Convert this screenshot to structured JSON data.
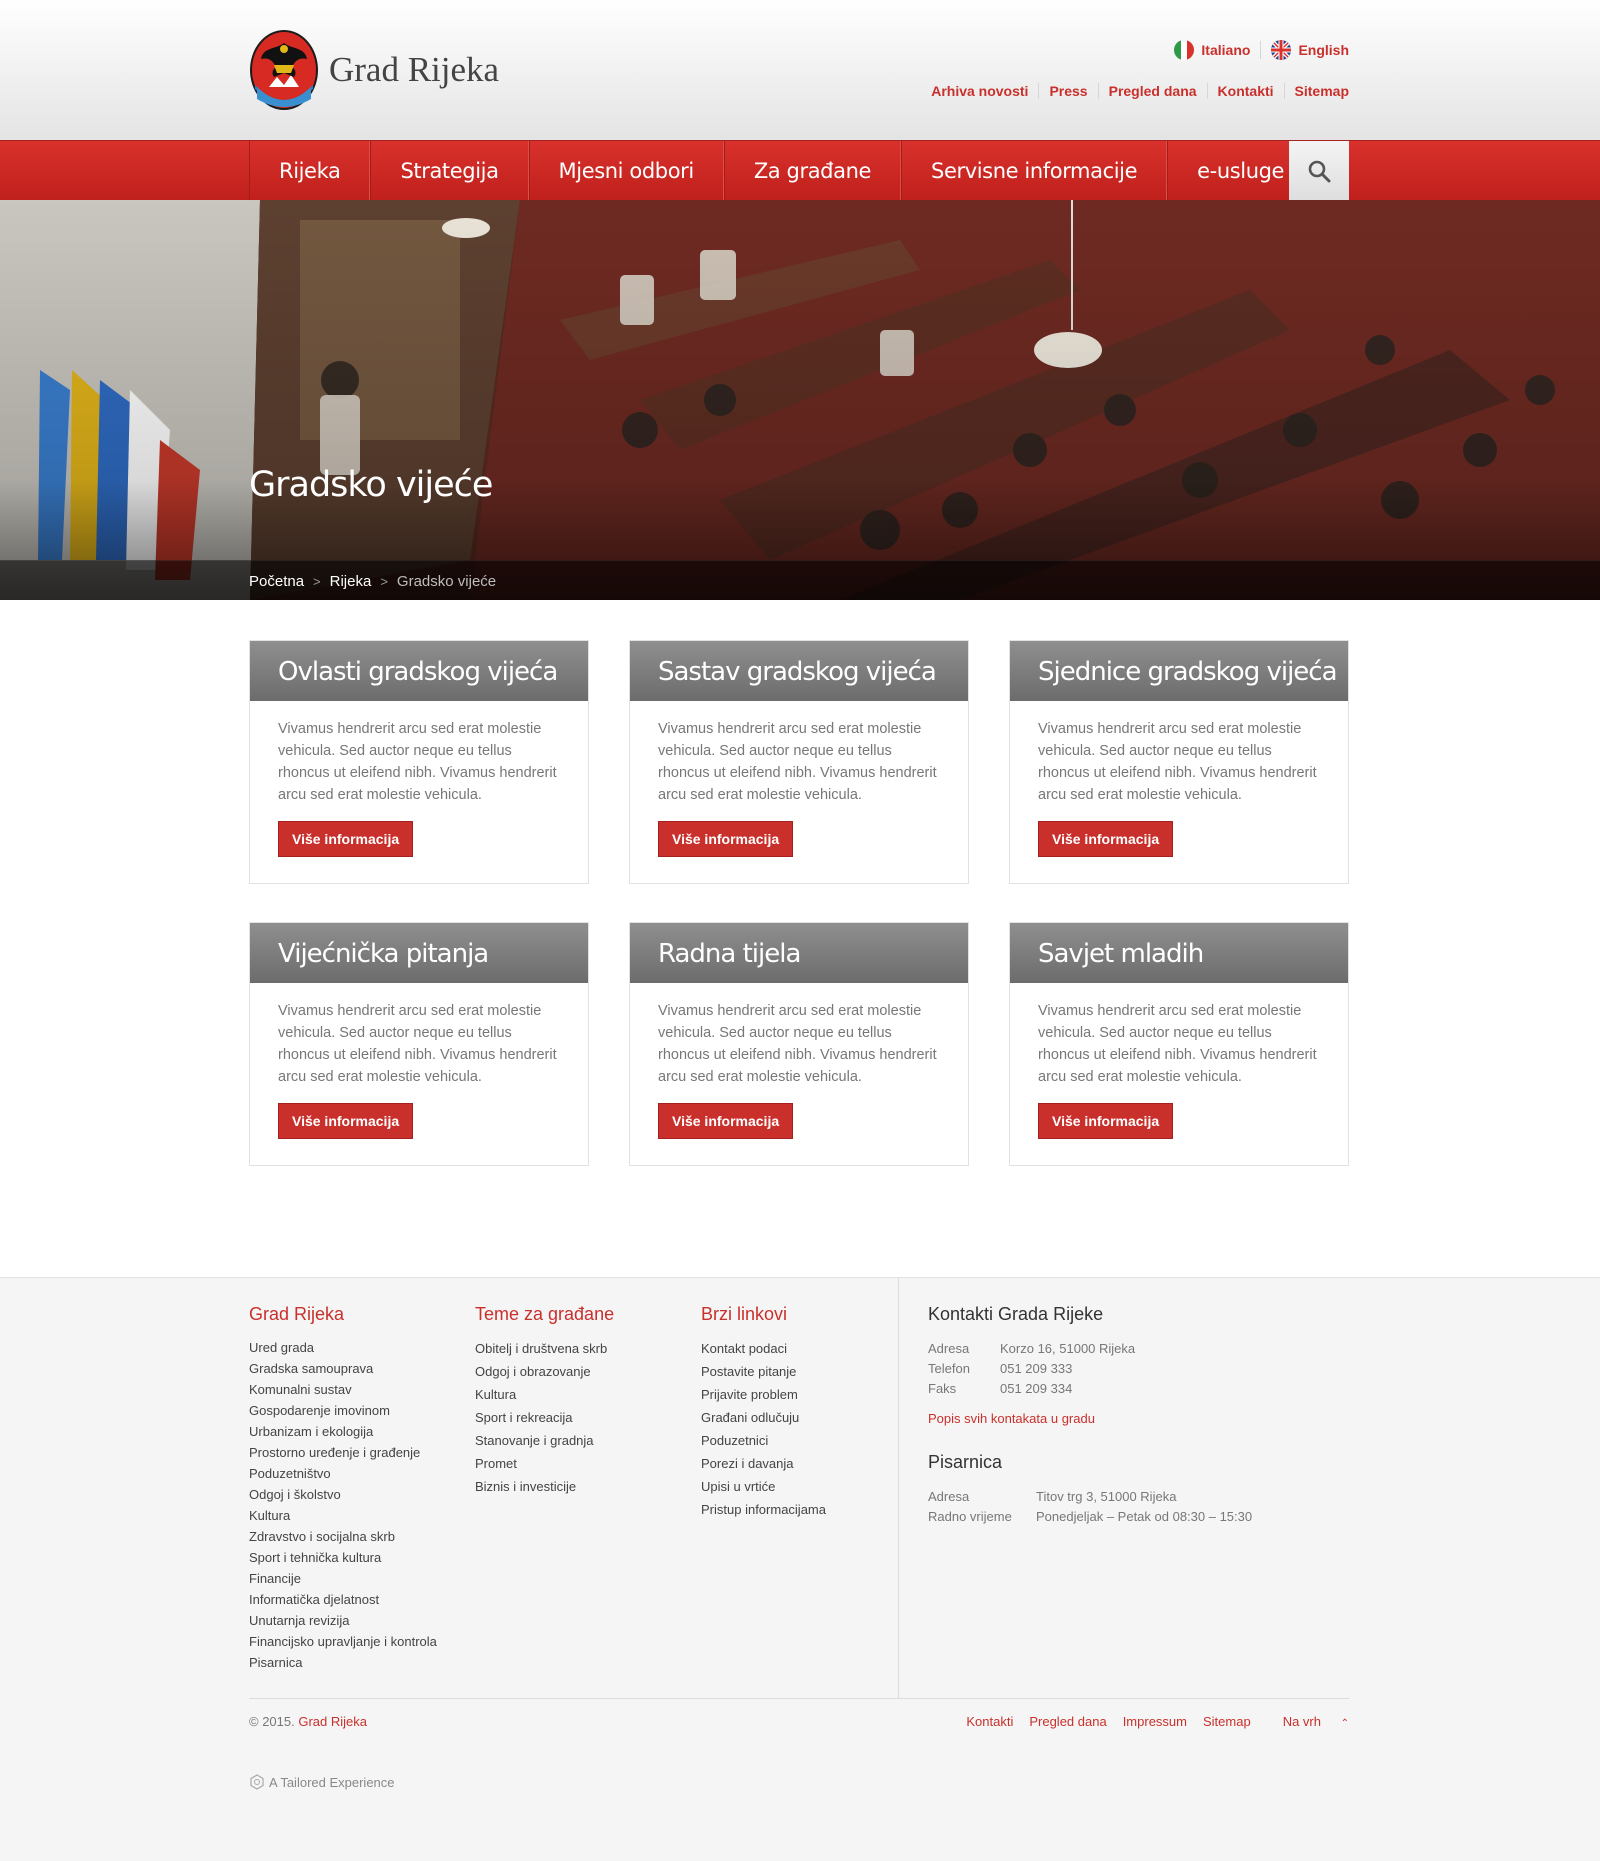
{
  "header": {
    "site_name": "Grad Rijeka",
    "languages": [
      {
        "label": "Italiano",
        "icon": "italy-flag-icon"
      },
      {
        "label": "English",
        "icon": "uk-flag-icon"
      }
    ],
    "top_links": [
      "Arhiva novosti",
      "Press",
      "Pregled dana",
      "Kontakti",
      "Sitemap"
    ]
  },
  "nav": {
    "items": [
      "Rijeka",
      "Strategija",
      "Mjesni odbori",
      "Za građane",
      "Servisne informacije",
      "e-usluge"
    ],
    "search_icon": "search-icon"
  },
  "hero": {
    "title": "Gradsko vijeće",
    "breadcrumbs": [
      "Početna",
      "Rijeka",
      "Gradsko vijeće"
    ]
  },
  "cards": [
    {
      "title": "Ovlasti gradskog vijeća",
      "text": "Vivamus hendrerit arcu sed erat molestie vehicula. Sed auctor neque eu tellus rhoncus ut eleifend nibh. Vivamus hendrerit arcu sed erat molestie vehicula.",
      "button": "Više informacija"
    },
    {
      "title": "Sastav gradskog vijeća",
      "text": "Vivamus hendrerit arcu sed erat molestie vehicula. Sed auctor neque eu tellus rhoncus ut eleifend nibh. Vivamus hendrerit arcu sed erat molestie vehicula.",
      "button": "Više informacija"
    },
    {
      "title": "Sjednice gradskog vijeća",
      "text": "Vivamus hendrerit arcu sed erat molestie vehicula. Sed auctor neque eu tellus rhoncus ut eleifend nibh. Vivamus hendrerit arcu sed erat molestie vehicula.",
      "button": "Više informacija"
    },
    {
      "title": "Vijećnička pitanja",
      "text": "Vivamus hendrerit arcu sed erat molestie vehicula. Sed auctor neque eu tellus rhoncus ut eleifend nibh. Vivamus hendrerit arcu sed erat molestie vehicula.",
      "button": "Više informacija"
    },
    {
      "title": "Radna tijela",
      "text": "Vivamus hendrerit arcu sed erat molestie vehicula. Sed auctor neque eu tellus rhoncus ut eleifend nibh. Vivamus hendrerit arcu sed erat molestie vehicula.",
      "button": "Više informacija"
    },
    {
      "title": "Savjet mladih",
      "text": "Vivamus hendrerit arcu sed erat molestie vehicula. Sed auctor neque eu tellus rhoncus ut eleifend nibh. Vivamus hendrerit arcu sed erat molestie vehicula.",
      "button": "Više informacija"
    }
  ],
  "footer": {
    "col1": {
      "title": "Grad Rijeka",
      "items": [
        "Ured grada",
        "Gradska samouprava",
        "Komunalni sustav",
        "Gospodarenje imovinom",
        "Urbanizam i ekologija",
        "Prostorno uređenje i građenje",
        "Poduzetništvo",
        "Odgoj i školstvo",
        "Kultura",
        "Zdravstvo i socijalna skrb",
        "Sport i tehnička kultura",
        "Financije",
        "Informatička djelatnost",
        "Unutarnja revizija",
        "Financijsko upravljanje i kontrola",
        "Pisarnica"
      ]
    },
    "col2": {
      "title": "Teme za građane",
      "items": [
        "Obitelj i društvena skrb",
        "Odgoj i obrazovanje",
        "Kultura",
        "Sport i rekreacija",
        "Stanovanje i gradnja",
        "Promet",
        "Biznis i investicije"
      ]
    },
    "col3": {
      "title": "Brzi linkovi",
      "items": [
        "Kontakt podaci",
        "Postavite pitanje",
        "Prijavite problem",
        "Građani odlučuju",
        "Poduzetnici",
        "Porezi i davanja",
        "Upisi u vrtiće",
        "Pristup informacijama"
      ]
    },
    "contacts": {
      "title": "Kontakti Grada Rijeke",
      "rows": [
        {
          "k": "Adresa",
          "v": "Korzo 16, 51000 Rijeka"
        },
        {
          "k": "Telefon",
          "v": "051 209 333"
        },
        {
          "k": "Faks",
          "v": "051 209 334"
        }
      ],
      "link": "Popis svih kontakata u gradu"
    },
    "pisarnica": {
      "title": "Pisarnica",
      "rows": [
        {
          "k": "Adresa",
          "v": "Titov trg 3, 51000 Rijeka"
        },
        {
          "k": "Radno vrijeme",
          "v": "Ponedjeljak – Petak od 08:30 – 15:30"
        }
      ]
    },
    "copyright_prefix": "© 2015.",
    "copyright_link": "Grad Rijeka",
    "bottom_links": [
      "Kontakti",
      "Pregled dana",
      "Impressum",
      "Sitemap",
      "Na vrh"
    ],
    "tailored": "A Tailored Experience"
  },
  "colors": {
    "accent": "#c9302c",
    "card_head": "#7a7a7a"
  }
}
